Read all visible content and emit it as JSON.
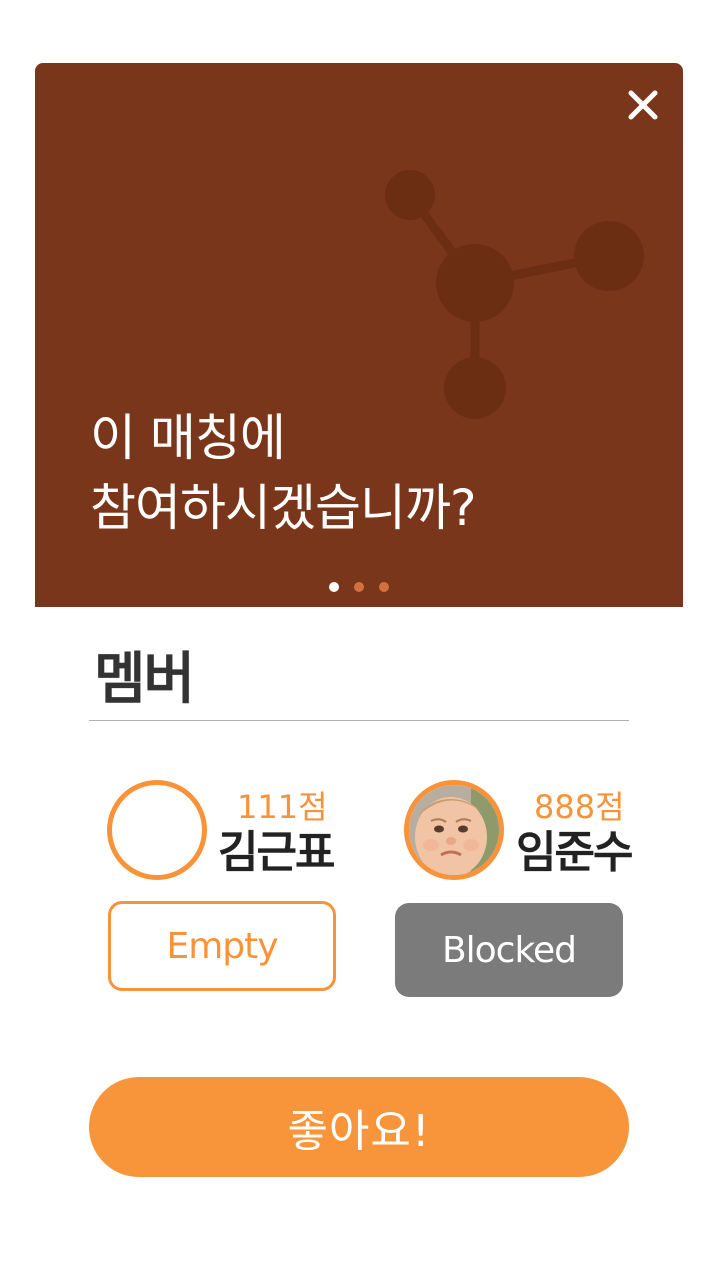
{
  "banner": {
    "title_line1": "이 매칭에",
    "title_line2": "참여하시겠습니까?",
    "close_icon": "close-icon",
    "background_color": "#7a361a",
    "carousel_pages": 3,
    "carousel_active": 1
  },
  "members_section": {
    "title": "멤버"
  },
  "members": [
    {
      "name": "김근표",
      "score": "111점",
      "avatar": "empty-avatar",
      "status": "Empty"
    },
    {
      "name": "임준수",
      "score": "888점",
      "avatar": "baby-photo-avatar",
      "status": "Blocked"
    }
  ],
  "actions": {
    "like_label": "좋아요!"
  },
  "colors": {
    "accent": "#f8933a",
    "blocked": "#7b7b7b",
    "banner": "#7a361a"
  }
}
